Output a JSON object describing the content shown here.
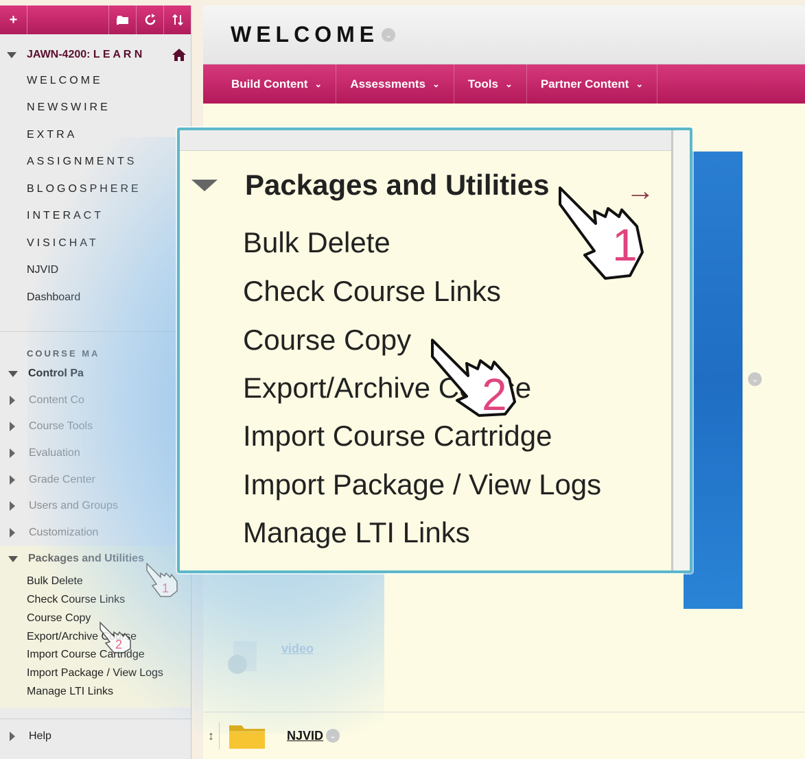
{
  "toolbar": {
    "add_label": "+",
    "folder_icon": "folder-icon",
    "refresh_icon": "refresh-icon",
    "sort_icon": "sort-icon"
  },
  "course": {
    "title": "JAWN-4200: L E A R N",
    "links": [
      {
        "label": "WELCOME"
      },
      {
        "label": "NEWSWIRE"
      },
      {
        "label": "EXTRA"
      },
      {
        "label": "ASSIGNMENTS"
      },
      {
        "label": "BLOGOSPHERE"
      },
      {
        "label": "INTERACT"
      },
      {
        "label": "VISICHAT"
      },
      {
        "label": "NJVID"
      },
      {
        "label": "Dashboard"
      }
    ]
  },
  "control_panel": {
    "section_label": "COURSE MA",
    "head_label": "Control Pa",
    "rows": [
      {
        "label": "Content Co"
      },
      {
        "label": "Course Tools"
      },
      {
        "label": "Evaluation"
      },
      {
        "label": "Grade Center"
      },
      {
        "label": "Users and Groups"
      },
      {
        "label": "Customization"
      }
    ],
    "packages_label": "Packages and Utilities",
    "packages_items": [
      {
        "label": "Bulk Delete"
      },
      {
        "label": "Check Course Links"
      },
      {
        "label": "Course Copy"
      },
      {
        "label": "Export/Archive Course"
      },
      {
        "label": "Import Course Cartridge"
      },
      {
        "label": "Import Package / View Logs"
      },
      {
        "label": "Manage LTI Links"
      }
    ],
    "help_label": "Help"
  },
  "main": {
    "page_title": "WELCOME",
    "action_bar": [
      {
        "label": "Build Content"
      },
      {
        "label": "Assessments"
      },
      {
        "label": "Tools"
      },
      {
        "label": "Partner Content"
      }
    ],
    "video_label": "video",
    "njvid_label": "NJVID"
  },
  "callout": {
    "title": "Packages and Utilities",
    "arrow": "→",
    "items": [
      {
        "label": "Bulk Delete"
      },
      {
        "label": "Check Course Links"
      },
      {
        "label": "Course Copy"
      },
      {
        "label": "Export/Archive Course"
      },
      {
        "label": "Import Course Cartridge"
      },
      {
        "label": "Import Package / View Logs"
      },
      {
        "label": "Manage LTI Links"
      }
    ],
    "step_1": "1",
    "step_2": "2"
  },
  "colors": {
    "brand": "#c52468",
    "callout_border": "#5bb8c9",
    "step_number": "#e0457f"
  }
}
